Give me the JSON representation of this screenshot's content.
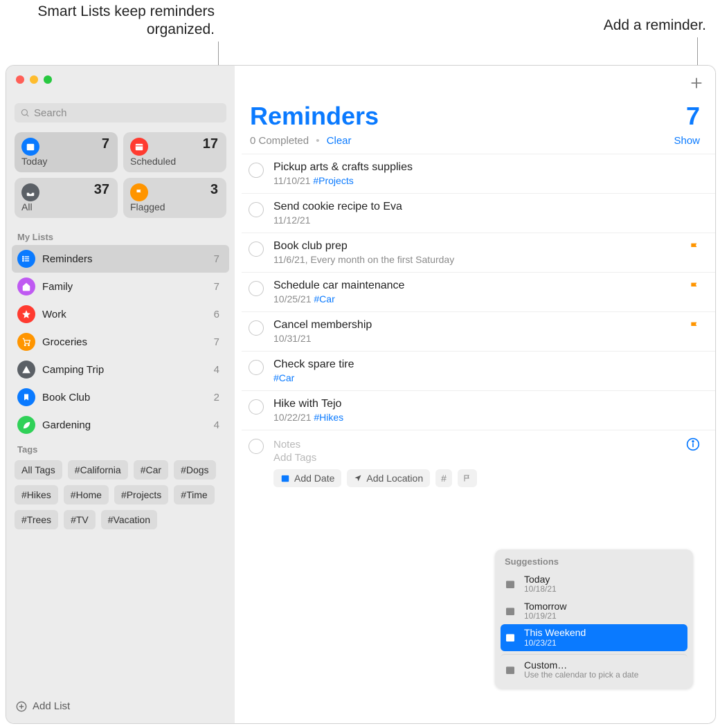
{
  "callouts": {
    "left": "Smart Lists keep reminders organized.",
    "right": "Add a reminder."
  },
  "search": {
    "placeholder": "Search"
  },
  "smart": [
    {
      "label": "Today",
      "count": "7",
      "icon": "calendar-today-icon",
      "color": "#0a7aff"
    },
    {
      "label": "Scheduled",
      "count": "17",
      "icon": "calendar-icon",
      "color": "#ff3b30"
    },
    {
      "label": "All",
      "count": "37",
      "icon": "tray-icon",
      "color": "#5b6066"
    },
    {
      "label": "Flagged",
      "count": "3",
      "icon": "flag-icon",
      "color": "#ff9500"
    }
  ],
  "sections": {
    "my_lists": "My Lists",
    "tags": "Tags"
  },
  "lists": [
    {
      "name": "Reminders",
      "count": "7",
      "color": "#0a7aff",
      "icon": "list-icon",
      "selected": true
    },
    {
      "name": "Family",
      "count": "7",
      "color": "#bf5af2",
      "icon": "house-icon"
    },
    {
      "name": "Work",
      "count": "6",
      "color": "#ff3b30",
      "icon": "star-icon"
    },
    {
      "name": "Groceries",
      "count": "7",
      "color": "#ff9500",
      "icon": "cart-icon"
    },
    {
      "name": "Camping Trip",
      "count": "4",
      "color": "#5b6066",
      "icon": "tent-icon"
    },
    {
      "name": "Book Club",
      "count": "2",
      "color": "#0a7aff",
      "icon": "bookmark-icon"
    },
    {
      "name": "Gardening",
      "count": "4",
      "color": "#30d158",
      "icon": "leaf-icon"
    }
  ],
  "tags": [
    "All Tags",
    "#California",
    "#Car",
    "#Dogs",
    "#Hikes",
    "#Home",
    "#Projects",
    "#Time",
    "#Trees",
    "#TV",
    "#Vacation"
  ],
  "footer": {
    "add_list": "Add List"
  },
  "header": {
    "title": "Reminders",
    "count": "7"
  },
  "subhead": {
    "completed": "0 Completed",
    "dot": "•",
    "clear": "Clear",
    "show": "Show"
  },
  "reminders": [
    {
      "title": "Pickup arts & crafts supplies",
      "meta_date": "11/10/21",
      "meta_tag": "#Projects",
      "flagged": false
    },
    {
      "title": "Send cookie recipe to Eva",
      "meta_date": "11/12/21",
      "meta_tag": "",
      "flagged": false
    },
    {
      "title": "Book club prep",
      "meta_date": "11/6/21, Every month on the first Saturday",
      "meta_tag": "",
      "flagged": true
    },
    {
      "title": "Schedule car maintenance",
      "meta_date": "10/25/21",
      "meta_tag": "#Car",
      "flagged": true
    },
    {
      "title": "Cancel membership",
      "meta_date": "10/31/21",
      "meta_tag": "",
      "flagged": true
    },
    {
      "title": "Check spare tire",
      "meta_date": "",
      "meta_tag": "#Car",
      "flagged": false
    },
    {
      "title": "Hike with Tejo",
      "meta_date": "10/22/21",
      "meta_tag": "#Hikes",
      "flagged": false
    }
  ],
  "new_item": {
    "notes": "Notes",
    "add_tags": "Add Tags",
    "chips": {
      "add_date": "Add Date",
      "add_location": "Add Location"
    }
  },
  "suggest": {
    "title": "Suggestions",
    "items": [
      {
        "t": "Today",
        "d": "10/18/21",
        "selected": false
      },
      {
        "t": "Tomorrow",
        "d": "10/19/21",
        "selected": false
      },
      {
        "t": "This Weekend",
        "d": "10/23/21",
        "selected": true
      },
      {
        "t": "Custom…",
        "d": "Use the calendar to pick a date",
        "selected": false,
        "sep": true
      }
    ]
  }
}
